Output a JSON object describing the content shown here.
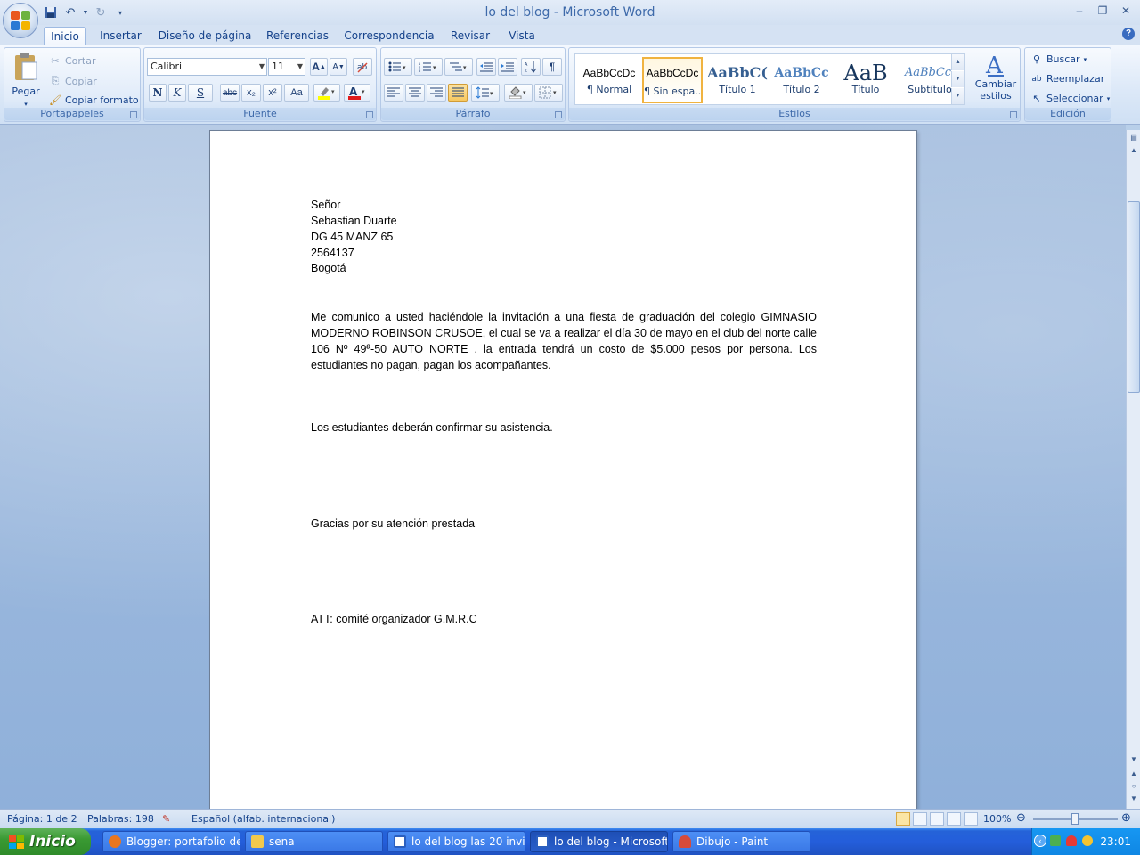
{
  "window": {
    "title": "lo del blog - Microsoft Word"
  },
  "tabs": [
    "Inicio",
    "Insertar",
    "Diseño de página",
    "Referencias",
    "Correspondencia",
    "Revisar",
    "Vista"
  ],
  "ribbon": {
    "portapapeles": {
      "label": "Portapapeles",
      "paste": "Pegar",
      "cut": "Cortar",
      "copy": "Copiar",
      "format_painter": "Copiar formato"
    },
    "fuente": {
      "label": "Fuente",
      "font_name": "Calibri",
      "font_size": "11",
      "bold": "N",
      "italic": "K",
      "underline": "S",
      "strike": "abc",
      "sub": "x₂",
      "sup": "x²",
      "case": "Aa",
      "grow": "A",
      "shrink": "A"
    },
    "parrafo": {
      "label": "Párrafo",
      "pilcrow": "¶"
    },
    "estilos": {
      "label": "Estilos",
      "change_styles": "Cambiar estilos",
      "items": [
        {
          "sample": "AaBbCcDc",
          "name": "¶ Normal"
        },
        {
          "sample": "AaBbCcDc",
          "name": "¶ Sin espa..."
        },
        {
          "sample": "AaBbC(",
          "name": "Título 1"
        },
        {
          "sample": "AaBbCc",
          "name": "Título 2"
        },
        {
          "sample": "AaB",
          "name": "Título"
        },
        {
          "sample": "AaBbCc.",
          "name": "Subtítulo"
        }
      ]
    },
    "edicion": {
      "label": "Edición",
      "find": "Buscar",
      "replace": "Reemplazar",
      "select": "Seleccionar"
    }
  },
  "document": {
    "address": [
      "Señor",
      "Sebastian Duarte",
      "DG 45 MANZ 65",
      "2564137",
      "Bogotá"
    ],
    "body": "Me comunico a usted haciéndole la invitación a una fiesta de graduación del colegio GIMNASIO MODERNO ROBINSON CRUSOE, el cual se va a realizar el día 30 de mayo en el club del norte calle 106 Nº 49ª-50 AUTO NORTE , la entrada tendrá un costo de $5.000 pesos por persona. Los estudiantes no pagan, pagan los acompañantes.",
    "confirm": "Los estudiantes deberán confirmar su asistencia.",
    "thanks": "Gracias por su atención prestada",
    "signature": "ATT: comité organizador G.M.R.C"
  },
  "status": {
    "page": "Página: 1 de 2",
    "words": "Palabras: 198",
    "language": "Español (alfab. internacional)",
    "zoom": "100%"
  },
  "taskbar": {
    "start": "Inicio",
    "items": [
      {
        "label": "Blogger: portafolio de...",
        "color": "#e8761f"
      },
      {
        "label": "sena",
        "color": "#f2c94c"
      },
      {
        "label": "lo del blog las 20 invit...",
        "color": "#2b5fbf"
      },
      {
        "label": "lo del blog - Microsoft...",
        "color": "#2b5fbf"
      },
      {
        "label": "Dibujo - Paint",
        "color": "#d64b3a"
      }
    ],
    "clock": "23:01"
  }
}
